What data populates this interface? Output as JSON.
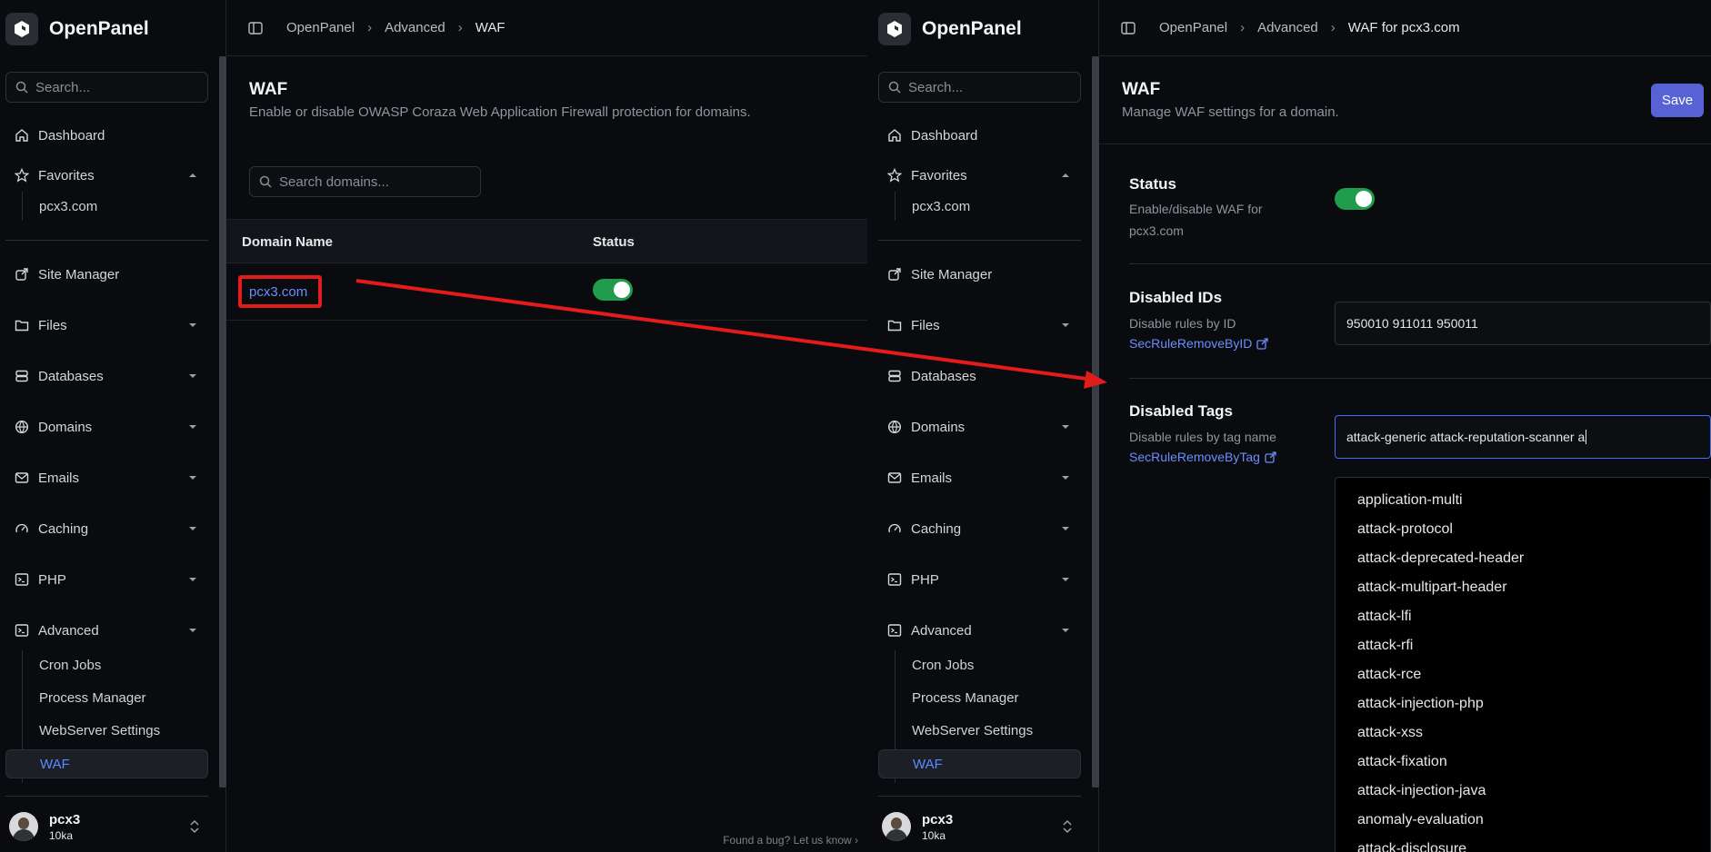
{
  "app": {
    "name": "OpenPanel"
  },
  "sidebar": {
    "search_placeholder": "Search...",
    "dashboard": "Dashboard",
    "favorites": "Favorites",
    "favorite_item": "pcx3.com",
    "site_manager": "Site Manager",
    "files": "Files",
    "databases": "Databases",
    "domains": "Domains",
    "emails": "Emails",
    "caching": "Caching",
    "php": "PHP",
    "advanced": "Advanced",
    "advanced_items": [
      "Cron Jobs",
      "Process Manager",
      "WebServer Settings",
      "WAF"
    ],
    "user": {
      "name": "pcx3",
      "sub": "10ka"
    }
  },
  "left": {
    "breadcrumb": [
      "OpenPanel",
      "Advanced",
      "WAF"
    ],
    "title": "WAF",
    "subtitle": "Enable or disable OWASP Coraza Web Application Firewall protection for domains.",
    "search_placeholder": "Search domains...",
    "table": {
      "headers": [
        "Domain Name",
        "Status"
      ],
      "rows": [
        {
          "domain": "pcx3.com",
          "status": "on"
        }
      ]
    },
    "footer": "Found a bug? Let us know"
  },
  "right": {
    "breadcrumb": [
      "OpenPanel",
      "Advanced",
      "WAF for pcx3.com"
    ],
    "title": "WAF",
    "subtitle": "Manage WAF settings for a domain.",
    "save_label": "Save",
    "status": {
      "title": "Status",
      "desc": "Enable/disable WAF for pcx3.com",
      "enabled": true
    },
    "disabled_ids": {
      "title": "Disabled IDs",
      "desc": "Disable rules by ID",
      "link": "SecRuleRemoveByID",
      "value": "950010 911011 950011"
    },
    "disabled_tags": {
      "title": "Disabled Tags",
      "desc": "Disable rules by tag name",
      "link": "SecRuleRemoveByTag",
      "value": "attack-generic attack-reputation-scanner a"
    },
    "suggestions": [
      "application-multi",
      "attack-protocol",
      "attack-deprecated-header",
      "attack-multipart-header",
      "attack-lfi",
      "attack-rfi",
      "attack-rce",
      "attack-injection-php",
      "attack-xss",
      "attack-fixation",
      "attack-injection-java",
      "anomaly-evaluation",
      "attack-disclosure"
    ]
  },
  "colors": {
    "accent": "#5762d5",
    "link": "#6b8dff",
    "toggle_on": "#1f9d4d",
    "highlight": "#e21b1b"
  }
}
